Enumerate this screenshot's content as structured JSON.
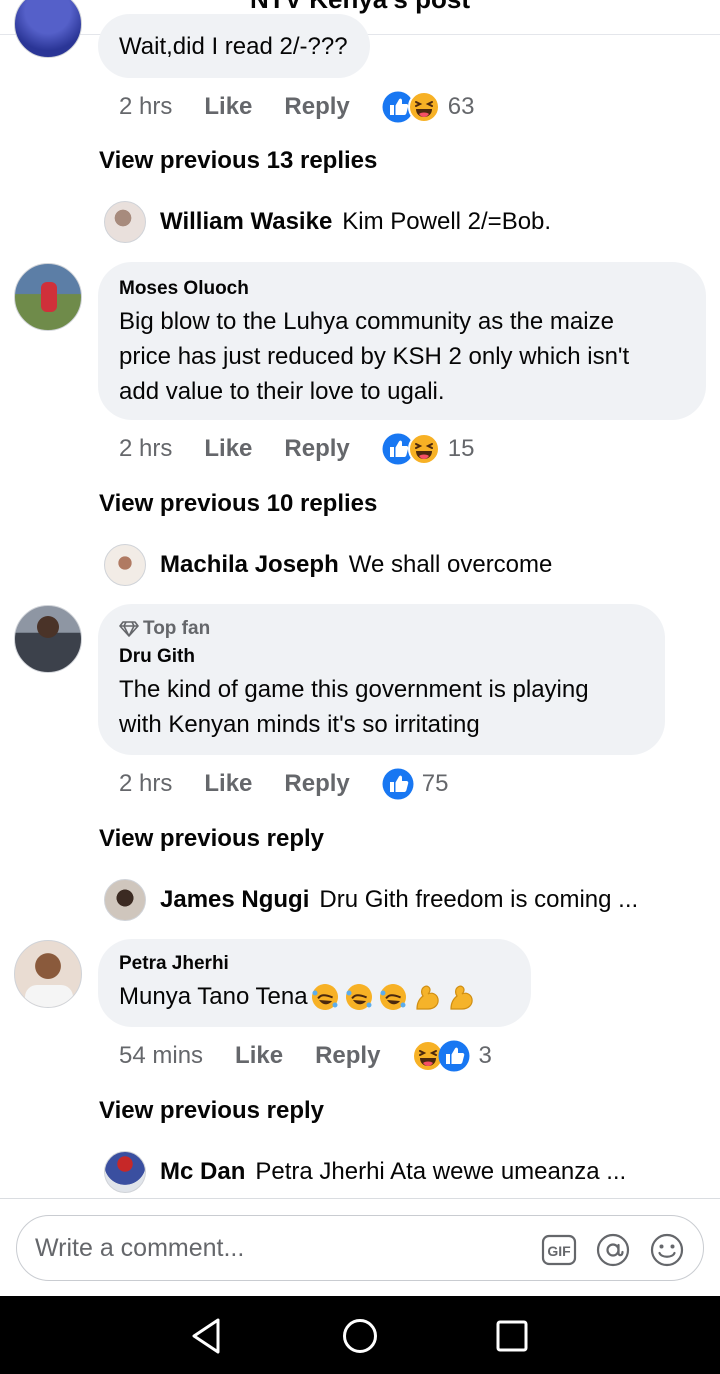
{
  "header": {
    "title": "NTV Kenya's post"
  },
  "comments": [
    {
      "text": "Wait,did I read 2/-???",
      "time": "2 hrs",
      "like_label": "Like",
      "reply_label": "Reply",
      "reactions": [
        "like-icon",
        "haha-icon"
      ],
      "reaction_count": "63",
      "view_previous": "View previous 13 replies",
      "last_reply": {
        "author": "William Wasike",
        "text": "Kim Powell 2/=Bob."
      }
    },
    {
      "author": "Moses Oluoch",
      "text_lines": [
        "Big blow to the Luhya community as the maize",
        "price has just reduced by KSH 2 only which isn't",
        "add value to their love to ugali."
      ],
      "time": "2 hrs",
      "like_label": "Like",
      "reply_label": "Reply",
      "reactions": [
        "like-icon",
        "haha-icon"
      ],
      "reaction_count": "15",
      "view_previous": "View previous 10 replies",
      "last_reply": {
        "author": "Machila Joseph",
        "text": "We shall overcome"
      }
    },
    {
      "badge": "Top fan",
      "author": "Dru Gith",
      "text_lines": [
        "The kind of game this government is playing",
        "with Kenyan minds it's so irritating"
      ],
      "time": "2 hrs",
      "like_label": "Like",
      "reply_label": "Reply",
      "reactions": [
        "like-icon"
      ],
      "reaction_count": "75",
      "view_previous": "View previous reply",
      "last_reply": {
        "author": "James Ngugi",
        "text": "Dru Gith freedom is coming ..."
      }
    },
    {
      "author": "Petra Jherhi",
      "text": "Munya Tano Tena",
      "emojis": [
        "rolling-laughing-emoji",
        "rolling-laughing-emoji",
        "rolling-laughing-emoji",
        "flexed-biceps-emoji",
        "flexed-biceps-emoji"
      ],
      "time": "54 mins",
      "like_label": "Like",
      "reply_label": "Reply",
      "reactions": [
        "haha-icon",
        "like-icon"
      ],
      "reaction_count": "3",
      "view_previous": "View previous reply",
      "last_reply": {
        "author": "Mc Dan",
        "text": "Petra Jherhi Ata wewe umeanza ..."
      }
    }
  ],
  "composer": {
    "placeholder": "Write a comment...",
    "gif_label": "GIF"
  },
  "icons": {
    "gif": "gif-icon",
    "mention": "at-mention-icon",
    "emoji": "smiley-icon",
    "back": "back-triangle-icon",
    "home": "home-circle-icon",
    "recents": "recents-square-icon"
  },
  "colors": {
    "like_blue": "#1877f2",
    "haha_yellow": "#f7b125",
    "meta_gray": "#65676b",
    "bubble_bg": "#f0f2f5"
  }
}
